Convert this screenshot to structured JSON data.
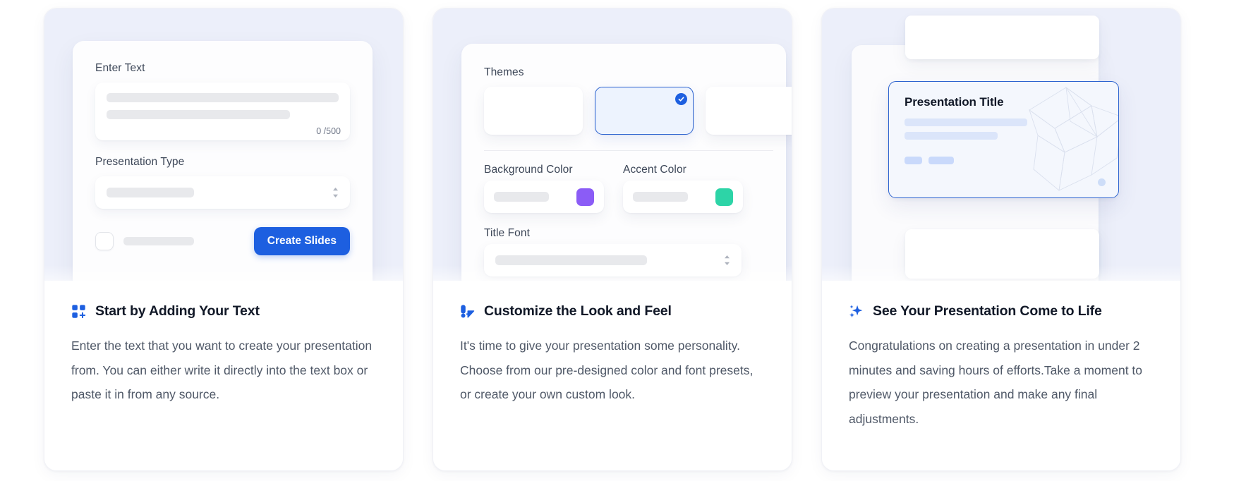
{
  "theme": {
    "accent_blue": "#1d5fe0",
    "illustration_bg": "#eceffa",
    "card_bg": "#ffffff",
    "purple_swatch": "#8b5cf6",
    "teal_swatch": "#2dd4a7",
    "selected_border": "#2b62cf"
  },
  "cards": [
    {
      "icon": "grid-plus-icon",
      "title": "Start by Adding Your Text",
      "description": "Enter the text that you want to create your presentation from. You can either write it directly into the text box or paste it in from any source.",
      "form": {
        "enter_text_label": "Enter Text",
        "char_counter": "0 /500",
        "presentation_type_label": "Presentation Type",
        "create_button": "Create Slides"
      }
    },
    {
      "icon": "paint-brush-icon",
      "title": "Customize the Look and Feel",
      "description": "It's time to give your presentation some personality. Choose from our pre-designed color and font presets, or create your own custom look.",
      "form": {
        "themes_label": "Themes",
        "background_color_label": "Background Color",
        "accent_color_label": "Accent Color",
        "title_font_label": "Title Font",
        "selected_theme_index": 1,
        "theme_count": 3
      }
    },
    {
      "icon": "sparkles-icon",
      "title": "See Your Presentation Come to Life",
      "description": "Congratulations on creating a presentation in under 2 minutes and saving hours of efforts.Take a moment to preview your presentation and make any final adjustments.",
      "preview": {
        "slide_title": "Presentation Title"
      }
    }
  ]
}
